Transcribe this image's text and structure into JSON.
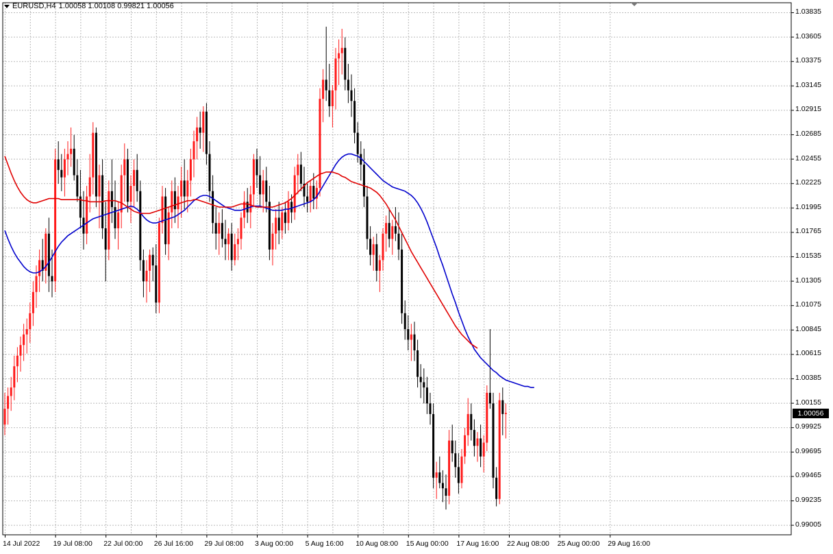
{
  "header": {
    "symbol": "EURUSD,H4",
    "ohlc": "1.00058 1.00108 0.99821 1.00056"
  },
  "price_badge": "1.00056",
  "colors": {
    "bull": "#ff1a1a",
    "bear": "#000000",
    "ma_fast": "#0000cc",
    "ma_slow": "#e00000",
    "grid": "#b8b8b8"
  },
  "chart_data": {
    "type": "candlestick",
    "title": "",
    "symbol": "EURUSD",
    "timeframe": "H4",
    "ylim": [
      0.98925,
      1.03918
    ],
    "y_ticks": [
      "1.03835",
      "1.03605",
      "1.03375",
      "1.03145",
      "1.02915",
      "1.02685",
      "1.02455",
      "1.02225",
      "1.01995",
      "1.01765",
      "1.01535",
      "1.01305",
      "1.01075",
      "1.00845",
      "1.00615",
      "1.00385",
      "1.00155",
      "0.99925",
      "0.99695",
      "0.99465",
      "0.99235",
      "0.99005"
    ],
    "x_ticks": [
      "14 Jul 2022",
      "19 Jul 08:00",
      "22 Jul 00:00",
      "26 Jul 16:00",
      "29 Jul 08:00",
      "3 Aug 00:00",
      "5 Aug 16:00",
      "10 Aug 08:00",
      "15 Aug 00:00",
      "17 Aug 16:00",
      "22 Aug 08:00",
      "25 Aug 00:00",
      "29 Aug 16:00"
    ],
    "x_tick_index": [
      0,
      16,
      32,
      48,
      64,
      80,
      96,
      112,
      128,
      144,
      160,
      176,
      192
    ],
    "grid": true,
    "last_price": 1.00056,
    "candles": [
      [
        0.9995,
        1.0025,
        0.9985,
        1.001
      ],
      [
        1.001,
        1.003,
        0.9995,
        1.0022
      ],
      [
        1.0022,
        1.004,
        1.0008,
        1.003
      ],
      [
        1.003,
        1.006,
        1.0018,
        1.005
      ],
      [
        1.005,
        1.0068,
        1.0035,
        1.006
      ],
      [
        1.006,
        1.0078,
        1.0045,
        1.007
      ],
      [
        1.007,
        1.009,
        1.0055,
        1.008
      ],
      [
        1.008,
        1.0095,
        1.0062,
        1.0085
      ],
      [
        1.0085,
        1.011,
        1.0072,
        1.01
      ],
      [
        1.01,
        1.013,
        1.0088,
        1.012
      ],
      [
        1.012,
        1.0145,
        1.0105,
        1.0135
      ],
      [
        1.0135,
        1.016,
        1.012,
        1.015
      ],
      [
        1.015,
        1.017,
        1.013,
        1.014
      ],
      [
        1.014,
        1.018,
        1.0128,
        1.0175
      ],
      [
        1.0175,
        1.019,
        1.012,
        1.0135
      ],
      [
        1.0135,
        1.016,
        1.0115,
        1.013
      ],
      [
        1.013,
        1.0255,
        1.012,
        1.0245
      ],
      [
        1.0245,
        1.0262,
        1.0222,
        1.0235
      ],
      [
        1.0235,
        1.025,
        1.0215,
        1.0228
      ],
      [
        1.0228,
        1.0255,
        1.021,
        1.0245
      ],
      [
        1.0245,
        1.0262,
        1.023,
        1.025
      ],
      [
        1.025,
        1.0275,
        1.0238,
        1.0255
      ],
      [
        1.0255,
        1.0268,
        1.0225,
        1.023
      ],
      [
        1.023,
        1.0245,
        1.0205,
        1.021
      ],
      [
        1.021,
        1.0235,
        1.018,
        1.019
      ],
      [
        1.019,
        1.0215,
        1.016,
        1.0175
      ],
      [
        1.0175,
        1.022,
        1.0165,
        1.021
      ],
      [
        1.021,
        1.025,
        1.0195,
        1.0228
      ],
      [
        1.0228,
        1.028,
        1.0212,
        1.027
      ],
      [
        1.027,
        1.0275,
        1.02,
        1.021
      ],
      [
        1.021,
        1.024,
        1.018,
        1.023
      ],
      [
        1.023,
        1.0245,
        1.017,
        1.018
      ],
      [
        1.018,
        1.0205,
        1.013,
        1.016
      ],
      [
        1.016,
        1.0225,
        1.015,
        1.0215
      ],
      [
        1.0215,
        1.0245,
        1.0185,
        1.02
      ],
      [
        1.02,
        1.0225,
        1.017,
        1.018
      ],
      [
        1.018,
        1.0205,
        1.016,
        1.0195
      ],
      [
        1.0195,
        1.024,
        1.018,
        1.023
      ],
      [
        1.023,
        1.026,
        1.0205,
        1.0245
      ],
      [
        1.0245,
        1.0255,
        1.0195,
        1.0205
      ],
      [
        1.0205,
        1.023,
        1.0185,
        1.022
      ],
      [
        1.022,
        1.0245,
        1.02,
        1.0235
      ],
      [
        1.0235,
        1.025,
        1.0205,
        1.0215
      ],
      [
        1.0215,
        1.0225,
        1.014,
        1.015
      ],
      [
        1.015,
        1.016,
        1.0115,
        1.013
      ],
      [
        1.013,
        1.015,
        1.011,
        1.014
      ],
      [
        1.014,
        1.016,
        1.012,
        1.0155
      ],
      [
        1.0155,
        1.0162,
        1.013,
        1.0145
      ],
      [
        1.0145,
        1.0165,
        1.01,
        1.011
      ],
      [
        1.011,
        1.019,
        1.01,
        1.0185
      ],
      [
        1.0185,
        1.022,
        1.0175,
        1.021
      ],
      [
        1.021,
        1.0218,
        1.0155,
        1.0165
      ],
      [
        1.0165,
        1.02,
        1.015,
        1.0195
      ],
      [
        1.0195,
        1.0225,
        1.018,
        1.0215
      ],
      [
        1.0215,
        1.0228,
        1.0185,
        1.0198
      ],
      [
        1.0198,
        1.022,
        1.018,
        1.021
      ],
      [
        1.021,
        1.0238,
        1.019,
        1.0225
      ],
      [
        1.0225,
        1.0245,
        1.0198,
        1.021
      ],
      [
        1.021,
        1.0235,
        1.0195,
        1.0225
      ],
      [
        1.0225,
        1.0255,
        1.021,
        1.0245
      ],
      [
        1.0245,
        1.0272,
        1.0228,
        1.0262
      ],
      [
        1.0262,
        1.0285,
        1.0245,
        1.0275
      ],
      [
        1.0275,
        1.029,
        1.0255,
        1.027
      ],
      [
        1.027,
        1.0295,
        1.0252,
        1.029
      ],
      [
        1.029,
        1.0298,
        1.024,
        1.025
      ],
      [
        1.025,
        1.0262,
        1.0205,
        1.0215
      ],
      [
        1.0215,
        1.023,
        1.0175,
        1.0185
      ],
      [
        1.0185,
        1.02,
        1.016,
        1.0175
      ],
      [
        1.0175,
        1.0195,
        1.0155,
        1.0185
      ],
      [
        1.0185,
        1.0198,
        1.0162,
        1.017
      ],
      [
        1.017,
        1.0188,
        1.015,
        1.0165
      ],
      [
        1.0165,
        1.018,
        1.015,
        1.0175
      ],
      [
        1.0175,
        1.0185,
        1.014,
        1.015
      ],
      [
        1.015,
        1.0175,
        1.0145,
        1.0165
      ],
      [
        1.0165,
        1.018,
        1.015,
        1.017
      ],
      [
        1.017,
        1.0195,
        1.016,
        1.019
      ],
      [
        1.019,
        1.0215,
        1.018,
        1.0205
      ],
      [
        1.0205,
        1.0218,
        1.0185,
        1.0195
      ],
      [
        1.0195,
        1.022,
        1.018,
        1.0212
      ],
      [
        1.0212,
        1.025,
        1.02,
        1.0245
      ],
      [
        1.0245,
        1.0255,
        1.0218,
        1.023
      ],
      [
        1.023,
        1.0248,
        1.02,
        1.0212
      ],
      [
        1.0212,
        1.0235,
        1.0195,
        1.0225
      ],
      [
        1.0225,
        1.0238,
        1.0195,
        1.0205
      ],
      [
        1.0205,
        1.022,
        1.015,
        1.016
      ],
      [
        1.016,
        1.0185,
        1.0145,
        1.0175
      ],
      [
        1.0175,
        1.0198,
        1.016,
        1.019
      ],
      [
        1.019,
        1.0205,
        1.0165,
        1.0178
      ],
      [
        1.0178,
        1.02,
        1.017,
        1.0195
      ],
      [
        1.0195,
        1.0205,
        1.0175,
        1.0185
      ],
      [
        1.0185,
        1.0215,
        1.0178,
        1.0205
      ],
      [
        1.0205,
        1.0212,
        1.0185,
        1.0195
      ],
      [
        1.0195,
        1.0238,
        1.0188,
        1.023
      ],
      [
        1.023,
        1.025,
        1.0212,
        1.024
      ],
      [
        1.024,
        1.0252,
        1.0215,
        1.0222
      ],
      [
        1.0222,
        1.0238,
        1.02,
        1.021
      ],
      [
        1.021,
        1.0222,
        1.0195,
        1.0205
      ],
      [
        1.0205,
        1.0225,
        1.0195,
        1.022
      ],
      [
        1.022,
        1.0232,
        1.0198,
        1.0208
      ],
      [
        1.0208,
        1.0225,
        1.0198,
        1.0218
      ],
      [
        1.0218,
        1.0312,
        1.021,
        1.0302
      ],
      [
        1.0302,
        1.033,
        1.028,
        1.032
      ],
      [
        1.032,
        1.037,
        1.03,
        1.031
      ],
      [
        1.031,
        1.0335,
        1.0285,
        1.0295
      ],
      [
        1.0295,
        1.0315,
        1.0275,
        1.031
      ],
      [
        1.031,
        1.035,
        1.0292,
        1.034
      ],
      [
        1.034,
        1.0358,
        1.0315,
        1.0345
      ],
      [
        1.0345,
        1.0368,
        1.0325,
        1.035
      ],
      [
        1.035,
        1.036,
        1.031,
        1.032
      ],
      [
        1.032,
        1.0335,
        1.0298,
        1.031
      ],
      [
        1.031,
        1.0325,
        1.0285,
        1.03
      ],
      [
        1.03,
        1.0312,
        1.026,
        1.027
      ],
      [
        1.027,
        1.028,
        1.0242,
        1.025
      ],
      [
        1.025,
        1.0262,
        1.0225,
        1.024
      ],
      [
        1.024,
        1.0255,
        1.02,
        1.021
      ],
      [
        1.021,
        1.022,
        1.016,
        1.017
      ],
      [
        1.017,
        1.0182,
        1.0145,
        1.0155
      ],
      [
        1.0155,
        1.0172,
        1.014,
        1.0165
      ],
      [
        1.0165,
        1.0175,
        1.013,
        1.014
      ],
      [
        1.014,
        1.0155,
        1.012,
        1.015
      ],
      [
        1.015,
        1.018,
        1.014,
        1.0175
      ],
      [
        1.0175,
        1.0192,
        1.0158,
        1.0185
      ],
      [
        1.0185,
        1.0198,
        1.0162,
        1.017
      ],
      [
        1.017,
        1.0188,
        1.0155,
        1.0182
      ],
      [
        1.0182,
        1.02,
        1.0168,
        1.0175
      ],
      [
        1.0175,
        1.0195,
        1.015,
        1.016
      ],
      [
        1.016,
        1.0175,
        1.009,
        1.01
      ],
      [
        1.01,
        1.0112,
        1.0075,
        1.0085
      ],
      [
        1.0085,
        1.0098,
        1.0065,
        1.0075
      ],
      [
        1.0075,
        1.009,
        1.0055,
        1.008
      ],
      [
        1.008,
        1.0092,
        1.0055,
        1.0065
      ],
      [
        1.0065,
        1.0075,
        1.003,
        1.004
      ],
      [
        1.004,
        1.0052,
        1.002,
        1.0035
      ],
      [
        1.0035,
        1.0048,
        1.0015,
        1.003
      ],
      [
        1.003,
        1.004,
        1.0005,
        1.0015
      ],
      [
        1.0015,
        1.0025,
        0.9995,
        1.0005
      ],
      [
        1.0005,
        1.0015,
        0.9935,
        0.9945
      ],
      [
        0.9945,
        0.996,
        0.9925,
        0.995
      ],
      [
        0.995,
        0.9965,
        0.9935,
        0.994
      ],
      [
        0.994,
        0.9952,
        0.9922,
        0.9935
      ],
      [
        0.9935,
        0.9948,
        0.9915,
        0.9928
      ],
      [
        0.9928,
        0.999,
        0.992,
        0.998
      ],
      [
        0.998,
        0.9995,
        0.996,
        0.9968
      ],
      [
        0.9968,
        0.998,
        0.9945,
        0.9955
      ],
      [
        0.9955,
        0.9968,
        0.993,
        0.994
      ],
      [
        0.994,
        0.9972,
        0.9935,
        0.9965
      ],
      [
        0.9965,
        0.9992,
        0.9958,
        0.9985
      ],
      [
        0.9985,
        1.002,
        0.9975,
        1.0005
      ],
      [
        1.0005,
        1.0015,
        0.998,
        0.999
      ],
      [
        0.999,
        1.0,
        0.9965,
        0.9975
      ],
      [
        0.9975,
        0.9988,
        0.996,
        0.9982
      ],
      [
        0.9982,
        0.9995,
        0.9955,
        0.9965
      ],
      [
        0.9965,
        0.9985,
        0.995,
        0.9978
      ],
      [
        0.9978,
        1.0032,
        0.997,
        1.0025
      ],
      [
        1.0025,
        1.0085,
        1.001,
        1.0015
      ],
      [
        1.0015,
        1.0025,
        0.9935,
        0.9945
      ],
      [
        0.9945,
        0.9955,
        0.9918,
        0.9925
      ],
      [
        0.9925,
        1.0025,
        0.992,
        1.0018
      ],
      [
        1.0018,
        1.003,
        0.9985,
        1.0005
      ],
      [
        1.0005,
        1.0015,
        0.9982,
        1.0006
      ]
    ],
    "series": [
      {
        "style": "moving-average",
        "color": "#0000cc",
        "values": [
          1.0178,
          1.017,
          1.0163,
          1.0157,
          1.0152,
          1.0148,
          1.0144,
          1.0141,
          1.0139,
          1.0138,
          1.0138,
          1.0139,
          1.0141,
          1.0144,
          1.0148,
          1.0153,
          1.0158,
          1.0163,
          1.0167,
          1.017,
          1.0173,
          1.0175,
          1.0177,
          1.0179,
          1.0181,
          1.0183,
          1.0185,
          1.0187,
          1.0189,
          1.019,
          1.0191,
          1.0192,
          1.0193,
          1.0194,
          1.0195,
          1.0196,
          1.0197,
          1.0198,
          1.0199,
          1.02,
          1.0201,
          1.02,
          1.0198,
          1.0195,
          1.0191,
          1.0188,
          1.0186,
          1.0185,
          1.0185,
          1.0186,
          1.0187,
          1.0188,
          1.0189,
          1.019,
          1.0191,
          1.0193,
          1.0195,
          1.0197,
          1.02,
          1.0203,
          1.0206,
          1.0208,
          1.021,
          1.0211,
          1.0211,
          1.021,
          1.0208,
          1.0206,
          1.0204,
          1.0202,
          1.02,
          1.0199,
          1.0198,
          1.0197,
          1.0197,
          1.0197,
          1.0198,
          1.0199,
          1.02,
          1.0201,
          1.0201,
          1.0201,
          1.02,
          1.0199,
          1.0198,
          1.0197,
          1.0197,
          1.0197,
          1.0197,
          1.0198,
          1.0198,
          1.0199,
          1.02,
          1.0201,
          1.0202,
          1.0203,
          1.0204,
          1.0205,
          1.0207,
          1.021,
          1.0215,
          1.022,
          1.0225,
          1.023,
          1.0235,
          1.024,
          1.0244,
          1.0247,
          1.0249,
          1.025,
          1.025,
          1.0249,
          1.0248,
          1.0246,
          1.0243,
          1.024,
          1.0237,
          1.0234,
          1.0231,
          1.0228,
          1.0225,
          1.0223,
          1.0221,
          1.0219,
          1.0218,
          1.0217,
          1.0216,
          1.0215,
          1.0213,
          1.0211,
          1.0208,
          1.0204,
          1.0199,
          1.0193,
          1.0186,
          1.0178,
          1.017,
          1.0162,
          1.0153,
          1.0145,
          1.0136,
          1.0127,
          1.0118,
          1.011,
          1.0101,
          1.0093,
          1.0085,
          1.0078,
          1.0072,
          1.0066,
          1.0062,
          1.0058,
          1.0055,
          1.0052,
          1.0049,
          1.0046,
          1.0044,
          1.0041,
          1.0039,
          1.0037,
          1.0036,
          1.0035,
          1.0034,
          1.0033,
          1.0032,
          1.0031,
          1.0031,
          1.003,
          1.003
        ]
      },
      {
        "style": "moving-average",
        "color": "#e00000",
        "values": [
          1.0248,
          1.024,
          1.0232,
          1.0225,
          1.0219,
          1.0214,
          1.021,
          1.0207,
          1.0205,
          1.0204,
          1.0204,
          1.0205,
          1.0206,
          1.0207,
          1.0208,
          1.0208,
          1.0208,
          1.0208,
          1.0207,
          1.0207,
          1.0207,
          1.0207,
          1.0207,
          1.0207,
          1.0207,
          1.0206,
          1.0206,
          1.0205,
          1.0205,
          1.0205,
          1.0205,
          1.0205,
          1.0206,
          1.0206,
          1.0206,
          1.0206,
          1.0205,
          1.0204,
          1.0202,
          1.02,
          1.0198,
          1.0196,
          1.0195,
          1.0194,
          1.0194,
          1.0194,
          1.0194,
          1.0195,
          1.0196,
          1.0197,
          1.0198,
          1.0199,
          1.02,
          1.0201,
          1.0202,
          1.0203,
          1.0204,
          1.0205,
          1.0206,
          1.0206,
          1.0207,
          1.0207,
          1.0206,
          1.0205,
          1.0204,
          1.0203,
          1.0202,
          1.0201,
          1.02,
          1.02,
          1.02,
          1.02,
          1.02,
          1.0201,
          1.0202,
          1.0203,
          1.0203,
          1.0203,
          1.0202,
          1.0201,
          1.02,
          1.02,
          1.02,
          1.02,
          1.02,
          1.02,
          1.0201,
          1.0202,
          1.0203,
          1.0204,
          1.0206,
          1.0208,
          1.0211,
          1.0214,
          1.0217,
          1.022,
          1.0223,
          1.0225,
          1.0227,
          1.0229,
          1.0231,
          1.0232,
          1.0233,
          1.0233,
          1.0233,
          1.0232,
          1.0231,
          1.0229,
          1.0228,
          1.0226,
          1.0224,
          1.0223,
          1.0222,
          1.0221,
          1.022,
          1.0219,
          1.0218,
          1.0216,
          1.0214,
          1.0211,
          1.0207,
          1.0203,
          1.0198,
          1.0193,
          1.0188,
          1.0182,
          1.0176,
          1.017,
          1.0164,
          1.0158,
          1.0153,
          1.0148,
          1.0143,
          1.0138,
          1.0133,
          1.0128,
          1.0123,
          1.0118,
          1.0113,
          1.0108,
          1.0103,
          1.0098,
          1.0093,
          1.0088,
          1.0084,
          1.008,
          1.0077,
          1.0074,
          1.0071,
          1.0069,
          1.0067
        ]
      }
    ]
  }
}
